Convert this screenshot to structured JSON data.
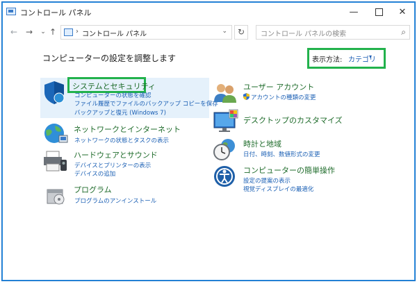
{
  "window": {
    "title": "コントロール パネル",
    "min": "—",
    "max": "",
    "close": "✕"
  },
  "nav": {
    "back": "←",
    "forward": "→",
    "down": "⌄",
    "up": "↑",
    "path_sep": "›",
    "path": "コントロール パネル",
    "dropdown": "⌄",
    "refresh": "↻",
    "search_placeholder": "コントロール パネルの検索",
    "search_icon": "⌕"
  },
  "header": {
    "title": "コンピューターの設定を調整します",
    "view_by_label": "表示方法:",
    "view_by_value": "カテゴリ",
    "view_by_arrow": "▾"
  },
  "categories": [
    {
      "title": "システムとセキュリティ",
      "links": [
        "コンピューターの状態を確認",
        "ファイル履歴でファイルのバックアップ コピーを保存",
        "バックアップと復元 (Windows 7)"
      ]
    },
    {
      "title": "ネットワークとインターネット",
      "links": [
        "ネットワークの状態とタスクの表示"
      ]
    },
    {
      "title": "ハードウェアとサウンド",
      "links": [
        "デバイスとプリンターの表示",
        "デバイスの追加"
      ]
    },
    {
      "title": "プログラム",
      "links": [
        "プログラムのアンインストール"
      ]
    },
    {
      "title": "ユーザー アカウント",
      "links": [
        "アカウントの種類の変更"
      ]
    },
    {
      "title": "デスクトップのカスタマイズ",
      "links": []
    },
    {
      "title": "時計と地域",
      "links": [
        "日付、時刻、数値形式の変更"
      ]
    },
    {
      "title": "コンピューターの簡単操作",
      "links": [
        "設定の提案の表示",
        "視覚ディスプレイの最適化"
      ]
    }
  ],
  "highlight_color": "#22b24c",
  "link_color": "#1a5fb4",
  "title_color": "#1e6b2a",
  "icons": [
    "shield-icon",
    "network-globe-icon",
    "printer-icon",
    "programs-icon",
    "users-icon",
    "desktop-monitor-icon",
    "clock-globe-icon",
    "ease-of-access-icon",
    "uac-shield-icon"
  ]
}
